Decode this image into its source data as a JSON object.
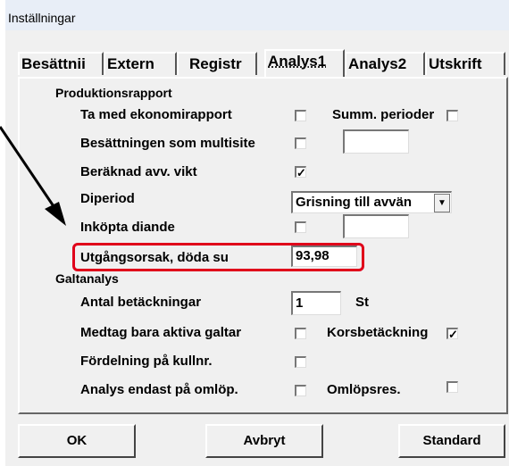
{
  "window": {
    "title": "Inställningar"
  },
  "tabs": [
    {
      "label": "Besättnii",
      "active": false
    },
    {
      "label": "Extern",
      "active": false
    },
    {
      "label": "Registr",
      "active": false
    },
    {
      "label": "Analys1",
      "active": true
    },
    {
      "label": "Analys2",
      "active": false
    },
    {
      "label": "Utskrift",
      "active": false
    }
  ],
  "production": {
    "heading": "Produktionsrapport",
    "ekonomi_label": "Ta med ekonomirapport",
    "summ_label": "Summ. perioder",
    "multisite_label": "Besättningen som multisite",
    "vikt_label": "Beräknad avv. vikt",
    "vikt_check": "✓",
    "diperiod_label": "Diperiod",
    "diperiod_value": "Grisning till avvän",
    "inkopta_label": "Inköpta diande",
    "utgang_label": "Utgångsorsak, döda su",
    "utgang_value": "93,98"
  },
  "galt": {
    "heading": "Galtanalys",
    "antal_label": "Antal betäckningar",
    "antal_value": "1",
    "antal_unit": "St",
    "medtag_label": "Medtag bara aktiva galtar",
    "kors_label": "Korsbetäckning",
    "kors_check": "✓",
    "fordelning_label": "Fördelning på kullnr.",
    "analys_label": "Analys endast på omlöp.",
    "omlop_label": "Omlöpsres."
  },
  "buttons": {
    "ok": "OK",
    "cancel": "Avbryt",
    "standard": "Standard"
  },
  "colors": {
    "highlight": "#e0001a",
    "arrow": "#000000"
  }
}
